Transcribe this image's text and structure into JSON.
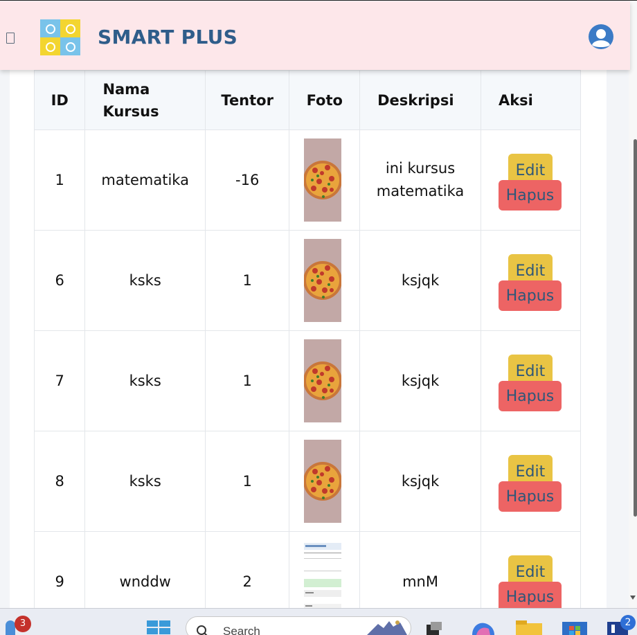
{
  "app": {
    "brand": "SMART PLUS"
  },
  "table": {
    "headers": {
      "id": "ID",
      "name": "Nama Kursus",
      "tentor": "Tentor",
      "foto": "Foto",
      "deskripsi": "Deskripsi",
      "aksi": "Aksi"
    },
    "rows": [
      {
        "id": "1",
        "name": "matematika",
        "tentor": "-16",
        "foto": "pizza-image",
        "deskripsi": "ini kursus matematika",
        "edit": "Edit",
        "hapus": "Hapus"
      },
      {
        "id": "6",
        "name": "ksks",
        "tentor": "1",
        "foto": "pizza-image",
        "deskripsi": "ksjqk",
        "edit": "Edit",
        "hapus": "Hapus"
      },
      {
        "id": "7",
        "name": "ksks",
        "tentor": "1",
        "foto": "pizza-image",
        "deskripsi": "ksjqk",
        "edit": "Edit",
        "hapus": "Hapus"
      },
      {
        "id": "8",
        "name": "ksks",
        "tentor": "1",
        "foto": "pizza-image",
        "deskripsi": "ksjqk",
        "edit": "Edit",
        "hapus": "Hapus"
      },
      {
        "id": "9",
        "name": "wnddw",
        "tentor": "2",
        "foto": "document-screenshot-image",
        "deskripsi": "mnM",
        "edit": "Edit",
        "hapus": "Hapus"
      }
    ]
  },
  "taskbar": {
    "widgets_badge": "3",
    "search_placeholder": "Search",
    "app_badge": "2"
  },
  "colors": {
    "navbar_bg": "#fde7ea",
    "brand_text": "#2f5d8a",
    "edit_button": "#e9c444",
    "hapus_button": "#ed6464",
    "button_text": "#2e5779"
  }
}
